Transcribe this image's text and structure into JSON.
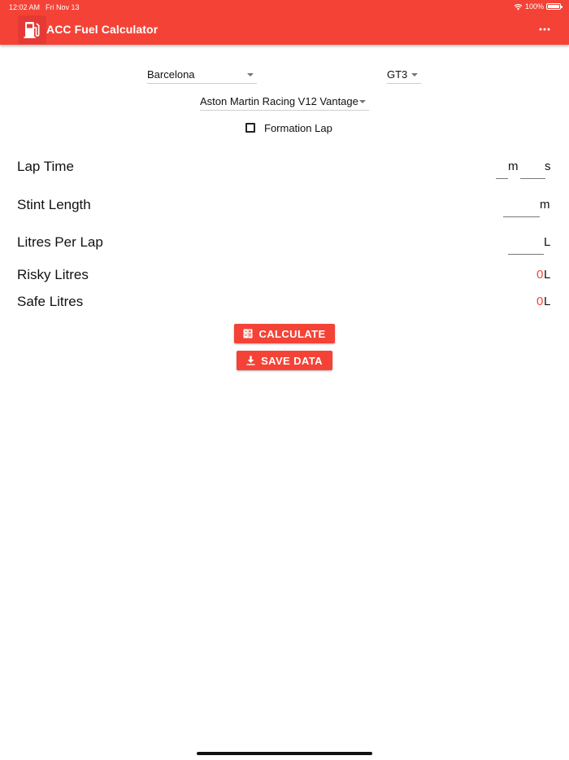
{
  "status_bar": {
    "time": "12:02 AM",
    "date": "Fri Nov 13",
    "battery": "100%"
  },
  "app": {
    "title": "ACC Fuel Calculator",
    "logo_icon": "fuel-pump-icon",
    "menu_icon": "more-horizontal-icon"
  },
  "colors": {
    "accent": "#f44336",
    "logo_bg": "#e53935",
    "text": "#111111"
  },
  "selectors": {
    "track": "Barcelona",
    "car_class": "GT3",
    "car": "Aston Martin Racing V12 Vantage"
  },
  "formation_lap": {
    "label": "Formation Lap",
    "checked": false
  },
  "form": {
    "lap_time": {
      "label": "Lap Time",
      "minutes_unit": "m",
      "seconds_unit": "s"
    },
    "stint_length": {
      "label": "Stint Length",
      "unit": "m"
    },
    "litres_per_lap": {
      "label": "Litres Per Lap",
      "unit": "L"
    }
  },
  "results": {
    "risky": {
      "label": "Risky Litres",
      "value": "0",
      "unit": "L"
    },
    "safe": {
      "label": "Safe Litres",
      "value": "0",
      "unit": "L"
    }
  },
  "buttons": {
    "calculate": {
      "label": "CALCULATE",
      "icon": "calculator-icon"
    },
    "save": {
      "label": "SAVE DATA",
      "icon": "download-icon"
    }
  }
}
